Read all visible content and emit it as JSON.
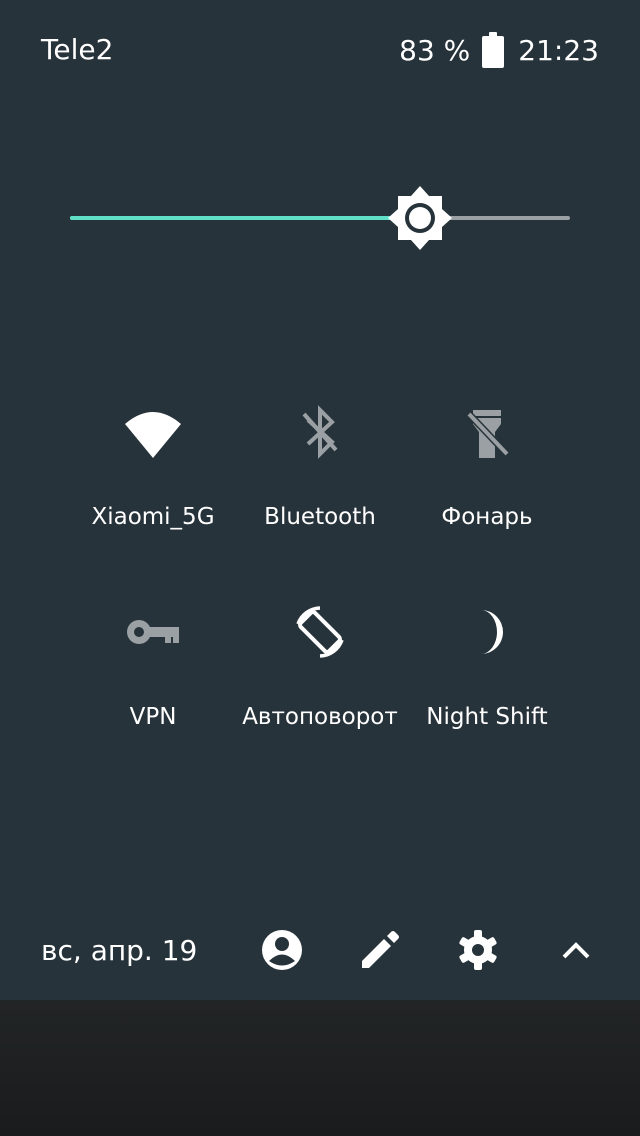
{
  "status_bar": {
    "carrier": "Tele2",
    "battery_percent": "83 %",
    "time": "21:23"
  },
  "brightness": {
    "level": 0.7
  },
  "tiles": [
    {
      "label": "Xiaomi_5G",
      "icon": "wifi-icon",
      "active": true
    },
    {
      "label": "Bluetooth",
      "icon": "bluetooth-off-icon",
      "active": false
    },
    {
      "label": "Фонарь",
      "icon": "flashlight-off-icon",
      "active": false
    },
    {
      "label": "VPN",
      "icon": "vpn-key-icon",
      "active": false
    },
    {
      "label": "Автоповорот",
      "icon": "auto-rotate-icon",
      "active": true
    },
    {
      "label": "Night Shift",
      "icon": "moon-icon",
      "active": true
    }
  ],
  "bottom_bar": {
    "date": "вс, апр. 19",
    "icons": [
      "account-icon",
      "edit-icon",
      "settings-icon",
      "collapse-icon"
    ]
  },
  "colors": {
    "panel_bg": "#27333a",
    "accent": "#5fe0c7",
    "active_icon": "#ffffff",
    "inactive_icon": "#9aa0a3"
  }
}
